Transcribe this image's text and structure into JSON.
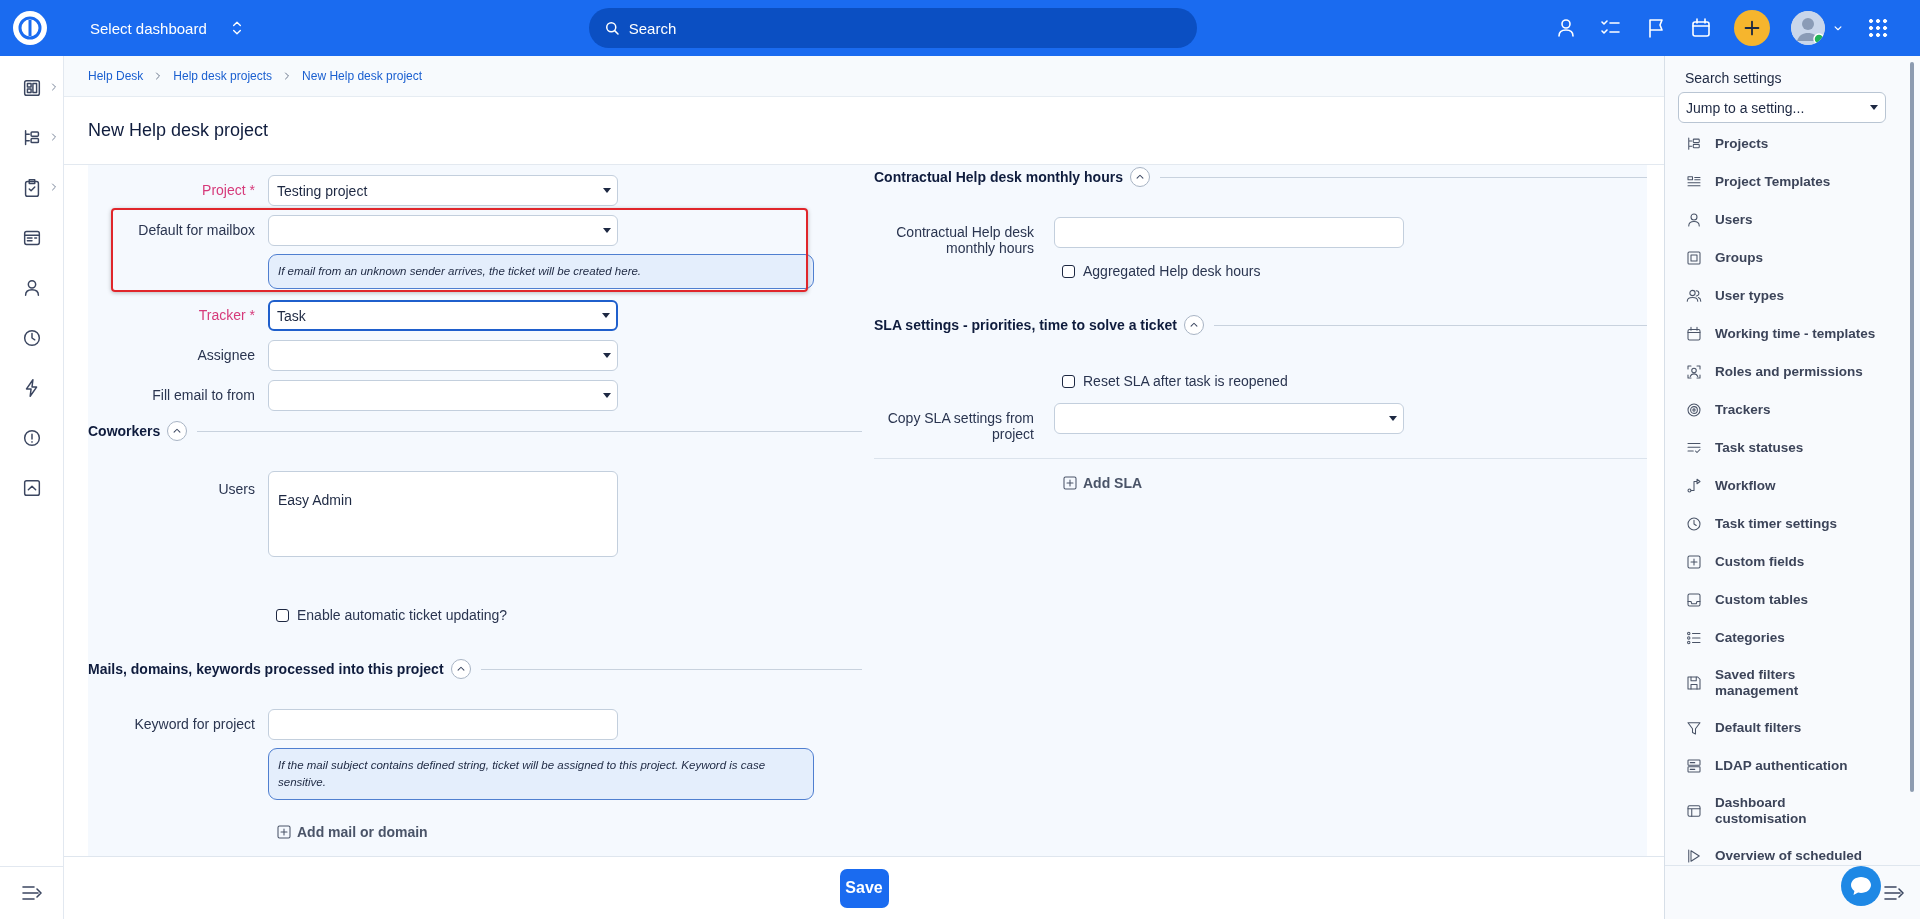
{
  "top_bar": {
    "dashboard_selector": "Select dashboard",
    "search": {
      "placeholder": "Search"
    }
  },
  "breadcrumbs": [
    {
      "label": "Help Desk"
    },
    {
      "label": "Help desk projects"
    },
    {
      "label": "New Help desk project"
    }
  ],
  "page_title": "New Help desk project",
  "left_column": [
    {
      "kind": "select",
      "label": "Project *",
      "required": true,
      "value": "Testing project",
      "focused": false
    },
    {
      "kind": "select",
      "label": "Default for mailbox",
      "required": false,
      "focused": false,
      "hint": "If email from an unknown sender arrives, the ticket will be created here.",
      "highlighted": true
    },
    {
      "kind": "select",
      "label": "Tracker *",
      "required": true,
      "value": "Task",
      "focused": true
    },
    {
      "kind": "select",
      "label": "Assignee",
      "required": false,
      "focused": false
    },
    {
      "kind": "select",
      "label": "Fill email to from",
      "required": false,
      "focused": false
    },
    {
      "kind": "heading",
      "title": "Coworkers",
      "expanded": true
    },
    {
      "kind": "textarea",
      "label": "Users",
      "value": "Easy Admin"
    },
    {
      "kind": "checkbox",
      "label": "Enable automatic ticket updating?",
      "checked": false
    },
    {
      "kind": "heading",
      "title": "Mails, domains, keywords processed into this project",
      "expanded": true
    },
    {
      "kind": "text",
      "label": "Keyword for project",
      "hint": "If the mail subject contains defined string, ticket will be assigned to this project. Keyword is case sensitive.",
      "highlighted": false
    },
    {
      "kind": "add",
      "label": "Add mail or domain"
    }
  ],
  "right_column": [
    {
      "kind": "heading",
      "title": "Contractual Help desk monthly hours",
      "expanded": true
    },
    {
      "kind": "text",
      "label": "Contractual Help desk monthly hours"
    },
    {
      "kind": "checkbox",
      "label": "Aggregated Help desk hours",
      "checked": false
    },
    {
      "kind": "heading",
      "title": "SLA settings - priorities, time to solve a ticket",
      "expanded": true
    },
    {
      "kind": "checkbox",
      "label": "Reset SLA after task is reopened",
      "checked": false
    },
    {
      "kind": "select",
      "label": "Copy SLA settings from project",
      "required": false,
      "focused": false
    },
    {
      "kind": "add",
      "label": "Add SLA"
    }
  ],
  "settings_panel": {
    "title": "Search settings",
    "jump": "Jump to a setting...",
    "items": [
      {
        "label": "Projects"
      },
      {
        "label": "Project Templates"
      },
      {
        "label": "Users"
      },
      {
        "label": "Groups"
      },
      {
        "label": "User types"
      },
      {
        "label": "Working time - templates"
      },
      {
        "label": "Roles and permissions"
      },
      {
        "label": "Trackers"
      },
      {
        "label": "Task statuses"
      },
      {
        "label": "Workflow"
      },
      {
        "label": "Task timer settings"
      },
      {
        "label": "Custom fields"
      },
      {
        "label": "Custom tables"
      },
      {
        "label": "Categories"
      },
      {
        "label": "Saved filters management"
      },
      {
        "label": "Default filters"
      },
      {
        "label": "LDAP authentication"
      },
      {
        "label": "Dashboard customisation"
      },
      {
        "label": "Overview of scheduled"
      }
    ]
  },
  "footer": {
    "save": "Save"
  }
}
